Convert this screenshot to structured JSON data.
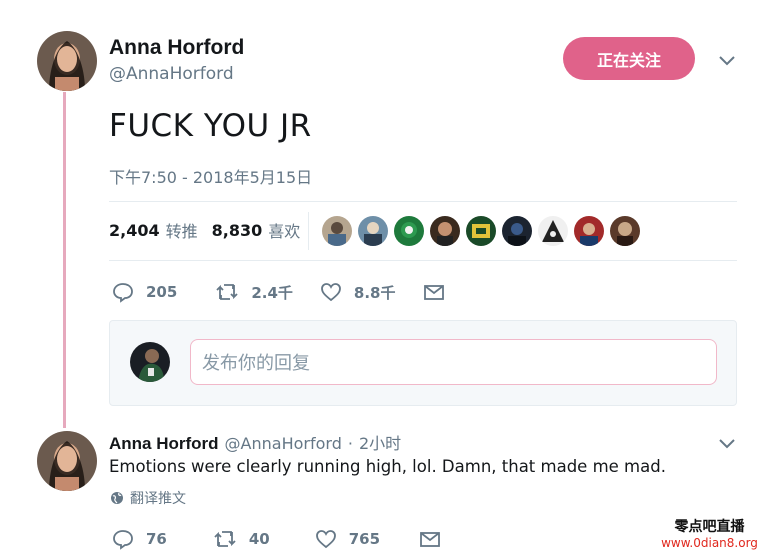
{
  "tweet": {
    "author_name": "Anna Horford",
    "author_handle": "@AnnaHorford",
    "follow_button_label": "正在关注",
    "text": "FUCK YOU JR",
    "timestamp": "下午7:50 - 2018年5月15日",
    "retweets_count": "2,404",
    "retweets_label": "转推",
    "likes_count": "8,830",
    "likes_label": "喜欢",
    "likers_avatar_count": 9,
    "actions": {
      "replies": "205",
      "retweets": "2.4千",
      "likes": "8.8千"
    }
  },
  "reply_composer": {
    "placeholder": "发布你的回复"
  },
  "reply": {
    "author_name": "Anna Horford",
    "author_handle": "@AnnaHorford",
    "separator": "·",
    "time_ago": "2小时",
    "text": "Emotions were clearly running high, lol. Damn, that made me mad.",
    "translate_label": "翻译推文",
    "actions": {
      "replies": "76",
      "retweets": "40",
      "likes": "765"
    }
  },
  "watermark": {
    "line1": "零点吧直播",
    "line2": "www.0dian8.org"
  },
  "colors": {
    "accent": "#e0628a",
    "thread_line": "#e6a9bd",
    "secondary_text": "#657786",
    "watermark_red": "#e0281e"
  },
  "icons": [
    "chevron-down-icon",
    "reply-icon",
    "retweet-icon",
    "like-icon",
    "message-icon",
    "globe-icon"
  ]
}
